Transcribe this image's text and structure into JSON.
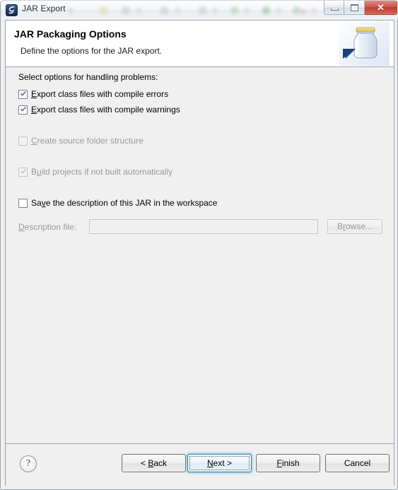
{
  "window": {
    "title": "JAR Export",
    "icon": "jar-export-icon",
    "controls": {
      "minimize": "minimize-icon",
      "maximize": "maximize-icon",
      "close": "✕"
    }
  },
  "header": {
    "title": "JAR Packaging Options",
    "description": "Define the options for the JAR export.",
    "graphic": "jar-icon"
  },
  "body": {
    "section_label": "Select options for handling problems:",
    "options": [
      {
        "label_pre": "",
        "mnemonic": "E",
        "label_post": "xport class files with compile errors",
        "checked": true,
        "enabled": true
      },
      {
        "label_pre": "",
        "mnemonic": "E",
        "label_post": "xport class files with compile warnings",
        "checked": true,
        "enabled": true
      },
      {
        "label_pre": "",
        "mnemonic": "C",
        "label_post": "reate source folder structure",
        "checked": false,
        "enabled": false
      },
      {
        "label_pre": "B",
        "mnemonic": "u",
        "label_post": "ild projects if not built automatically",
        "checked": true,
        "enabled": false
      },
      {
        "label_pre": "Sa",
        "mnemonic": "v",
        "label_post": "e the description of this JAR in the workspace",
        "checked": false,
        "enabled": true
      }
    ],
    "description_file": {
      "label_pre": "",
      "label_mnemonic": "D",
      "label_post": "escription file:",
      "value": "",
      "placeholder": "",
      "enabled": false,
      "browse_pre": "B",
      "browse_mnemonic": "r",
      "browse_post": "owse..."
    }
  },
  "footer": {
    "help": "?",
    "buttons": [
      {
        "pre": "< ",
        "mnemonic": "B",
        "post": "ack",
        "name": "back-button",
        "default": false
      },
      {
        "pre": "",
        "mnemonic": "N",
        "post": "ext >",
        "name": "next-button",
        "default": true
      },
      {
        "pre": "",
        "mnemonic": "F",
        "post": "inish",
        "name": "finish-button",
        "default": false
      },
      {
        "pre": "Cancel",
        "mnemonic": "",
        "post": "",
        "name": "cancel-button",
        "default": false
      }
    ]
  },
  "colors": {
    "dialog_bg": "#f0f0f0",
    "header_bg": "#ffffff",
    "close_red": "#c03c30",
    "focus_blue": "#3c7fb1",
    "disabled_text": "#9a9a9a"
  }
}
